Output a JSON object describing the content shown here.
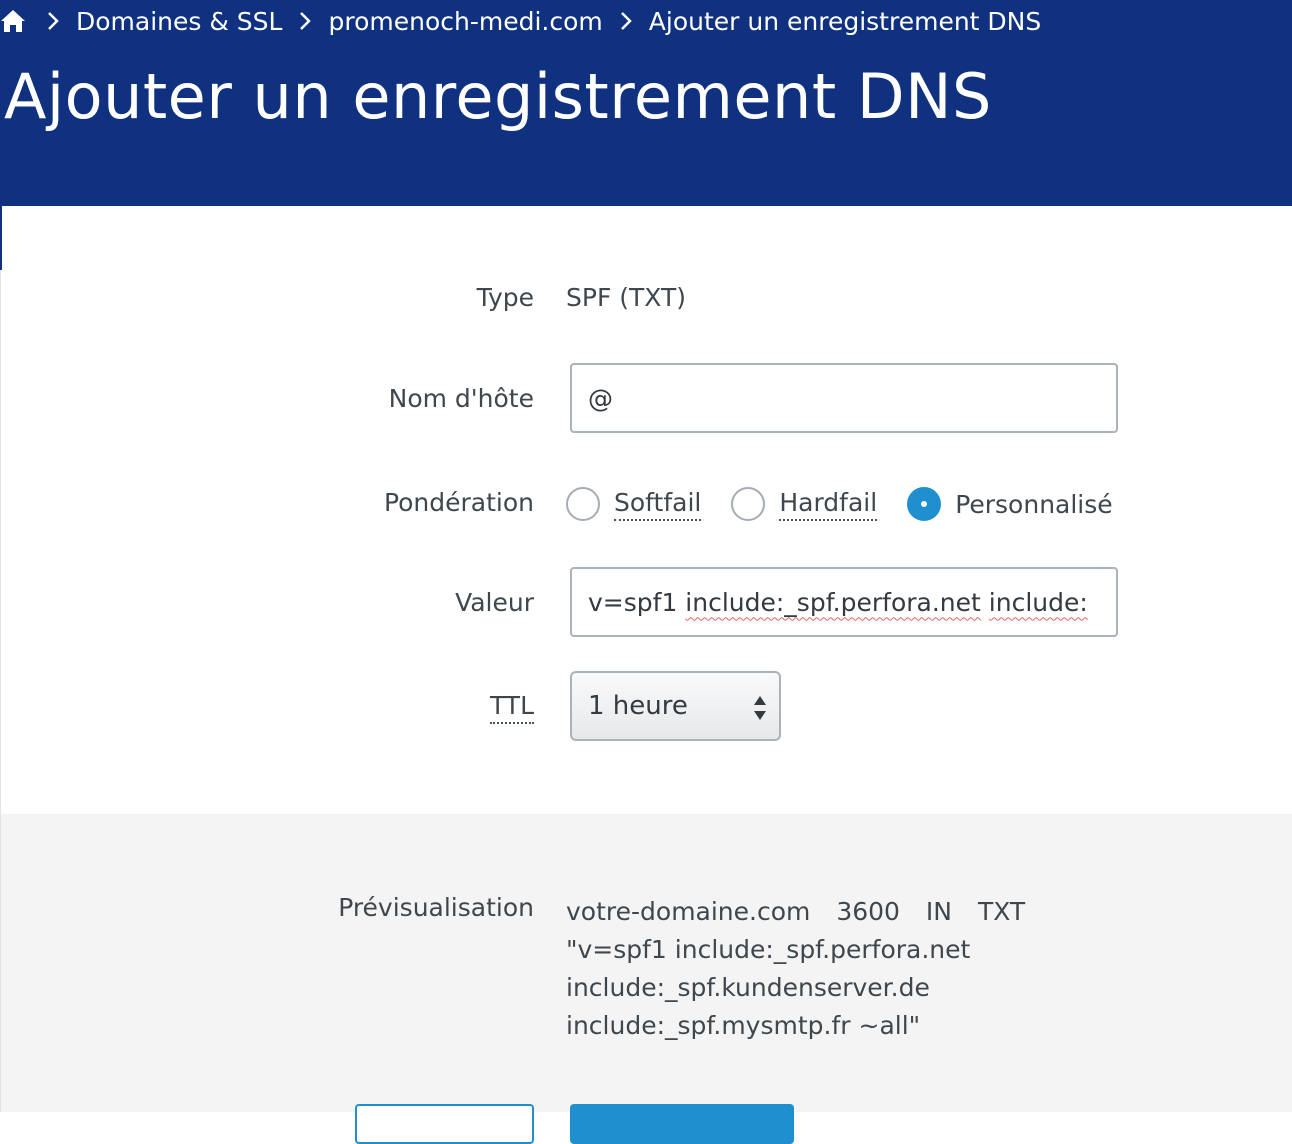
{
  "breadcrumb": {
    "home_icon": "home-icon",
    "items": [
      "Domaines & SSL",
      "promenoch-medi.com",
      "Ajouter un enregistrement DNS"
    ]
  },
  "page_title": "Ajouter un enregistrement DNS",
  "form": {
    "type": {
      "label": "Type",
      "value": "SPF (TXT)"
    },
    "hostname": {
      "label": "Nom d'hôte",
      "value": "@"
    },
    "weighting": {
      "label": "Pondération",
      "options": [
        "Softfail",
        "Hardfail",
        "Personnalisé"
      ],
      "selected": "Personnalisé"
    },
    "value": {
      "label": "Valeur",
      "value_prefix": "v=spf1 ",
      "value_word1": "include:_spf.perfora.net",
      "value_word2": "include:"
    },
    "ttl": {
      "label": "TTL",
      "value": "1 heure"
    }
  },
  "preview": {
    "label": "Prévisualisation",
    "domain": "votre-domaine.com",
    "ttl": "3600",
    "class": "IN",
    "type": "TXT",
    "lines": [
      "\"v=spf1 include:_spf.perfora.net",
      "include:_spf.kundenserver.de",
      "include:_spf.mysmtp.fr ~all\""
    ]
  },
  "colors": {
    "header_bg": "#0f3180",
    "accent": "#1f8fd0",
    "preview_bg": "#f4f4f4"
  }
}
